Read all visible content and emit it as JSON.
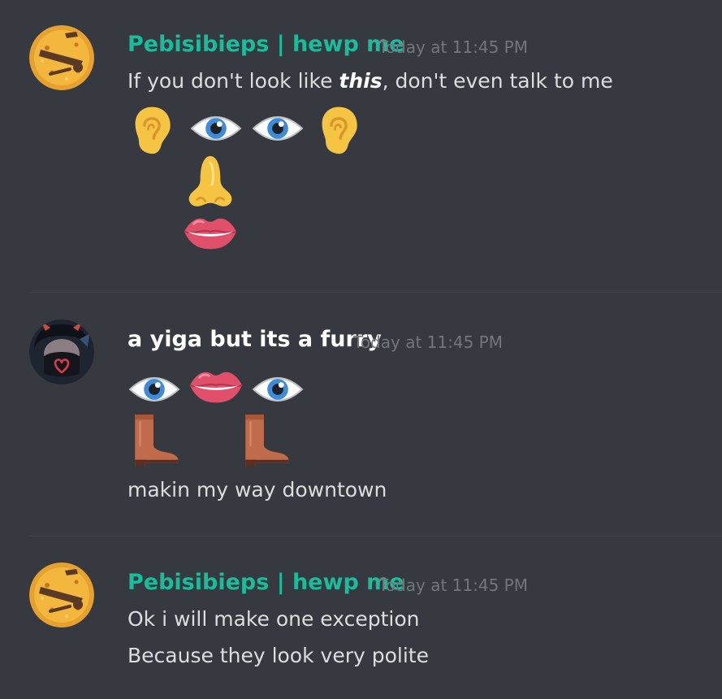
{
  "colors": {
    "background": "#36393f",
    "username_green": "#1abc9c",
    "username_white": "#ffffff",
    "timestamp": "#72767d",
    "text": "#dcddde",
    "divider": "#42454a"
  },
  "messages": [
    {
      "username": "Pebisibieps | hewp me",
      "timestamp": "Today at 11:45 PM",
      "text_before": "If you don't look like ",
      "text_emphasis": "this",
      "text_after": ", don't even talk to me",
      "emoji_rows": [
        [
          "ear-icon",
          "eye-icon",
          "eye-icon",
          "ear-icon"
        ],
        [
          "nose-icon"
        ],
        [
          "mouth-icon"
        ]
      ],
      "avatar_icon": "pizza-avatar-icon"
    },
    {
      "username": "a yiga but its a furry",
      "timestamp": "Today at 11:45 PM",
      "emoji_rows": [
        [
          "eye-icon",
          "mouth-icon",
          "eye-icon"
        ],
        [
          "boot-icon",
          "boot-icon"
        ]
      ],
      "lines": [
        "makin my way downtown"
      ],
      "avatar_icon": "masked-person-avatar-icon"
    },
    {
      "username": "Pebisibieps | hewp me",
      "timestamp": "Today at 11:45 PM",
      "lines": [
        "Ok i will make one exception",
        "Because they look very polite"
      ],
      "avatar_icon": "pizza-avatar-icon"
    }
  ]
}
